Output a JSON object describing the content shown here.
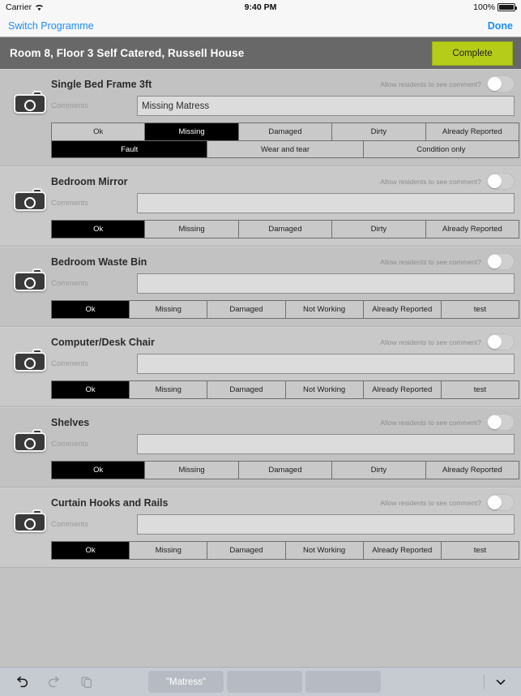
{
  "status_bar": {
    "carrier": "Carrier",
    "wifi_icon": "wifi-icon",
    "time": "9:40 PM",
    "battery_percent": "100%",
    "battery_icon": "battery-full-icon"
  },
  "nav_bar": {
    "left_label": "Switch Programme",
    "right_label": "Done"
  },
  "title_bar": {
    "title": "Room 8, Floor 3 Self Catered, Russell House",
    "complete_label": "Complete",
    "complete_color": "#b5cc18",
    "background_color": "#686868"
  },
  "common": {
    "comments_label": "Comments",
    "allow_toggle_label": "Allow residents to see comment?",
    "camera_icon": "camera-icon",
    "toggle_state": "off"
  },
  "items": [
    {
      "title": "Single Bed Frame 3ft",
      "comment": "Missing Matress",
      "comment_placeholder": "",
      "allow_residents": false,
      "segments": [
        "Ok",
        "Missing",
        "Damaged",
        "Dirty",
        "Already Reported"
      ],
      "selected": "Missing",
      "segments2": [
        "Fault",
        "Wear and tear",
        "Condition only"
      ],
      "selected2": "Fault"
    },
    {
      "title": "Bedroom Mirror",
      "comment": "",
      "comment_placeholder": "",
      "allow_residents": false,
      "segments": [
        "Ok",
        "Missing",
        "Damaged",
        "Dirty",
        "Already Reported"
      ],
      "selected": "Ok",
      "segments2": [],
      "selected2": ""
    },
    {
      "title": "Bedroom Waste Bin",
      "comment": "",
      "comment_placeholder": "",
      "allow_residents": false,
      "segments": [
        "Ok",
        "Missing",
        "Damaged",
        "Not Working",
        "Already Reported",
        "test"
      ],
      "selected": "Ok",
      "segments2": [],
      "selected2": ""
    },
    {
      "title": "Computer/Desk Chair",
      "comment": "",
      "comment_placeholder": "",
      "allow_residents": false,
      "segments": [
        "Ok",
        "Missing",
        "Damaged",
        "Not Working",
        "Already Reported",
        "test"
      ],
      "selected": "Ok",
      "segments2": [],
      "selected2": ""
    },
    {
      "title": "Shelves",
      "comment": "",
      "comment_placeholder": "",
      "allow_residents": false,
      "segments": [
        "Ok",
        "Missing",
        "Damaged",
        "Dirty",
        "Already Reported"
      ],
      "selected": "Ok",
      "segments2": [],
      "selected2": ""
    },
    {
      "title": "Curtain Hooks and Rails",
      "comment": "",
      "comment_placeholder": "",
      "allow_residents": false,
      "segments": [
        "Ok",
        "Missing",
        "Damaged",
        "Not Working",
        "Already Reported",
        "test"
      ],
      "selected": "Ok",
      "segments2": [],
      "selected2": ""
    }
  ],
  "keyboard_bar": {
    "undo_icon": "undo-icon",
    "redo_icon": "redo-icon",
    "paste_icon": "paste-icon",
    "suggestions": [
      "\"Matress\"",
      "",
      ""
    ],
    "dismiss_icon": "chevron-down-icon"
  }
}
